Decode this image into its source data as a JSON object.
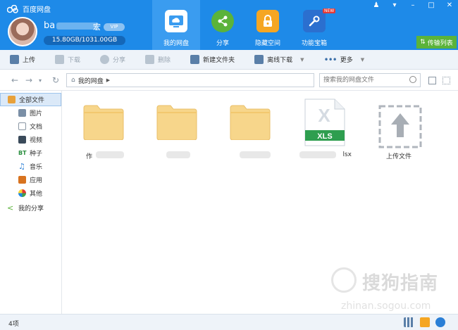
{
  "app": {
    "title": "百度网盘",
    "window_controls": [
      "bell-icon",
      "menu-icon",
      "minimize-icon",
      "maximize-icon",
      "close-icon"
    ]
  },
  "user": {
    "name": "ba",
    "name_tail": "宏",
    "vip_label": "VIP",
    "quota": "15.80GB/1031.00GB"
  },
  "nav_tabs": [
    {
      "label": "我的网盘",
      "icon": "cloud-disk-icon",
      "active": true
    },
    {
      "label": "分享",
      "icon": "share-icon",
      "active": false
    },
    {
      "label": "隐藏空间",
      "icon": "lock-icon",
      "active": false
    },
    {
      "label": "功能宝箱",
      "icon": "toolbox-icon",
      "active": false,
      "badge": "NEW"
    }
  ],
  "transfer_label": "传输列表",
  "toolbar": {
    "upload": "上传",
    "download": "下载",
    "share": "分享",
    "delete": "删除",
    "new_folder": "新建文件夹",
    "offline_download": "离线下载",
    "more": "更多"
  },
  "path": {
    "current": "我的网盘",
    "search_placeholder": "搜索我的网盘文件"
  },
  "sidebar": {
    "items": [
      {
        "label": "全部文件",
        "icon": "all-files-icon",
        "active": true
      },
      {
        "label": "图片",
        "icon": "image-icon"
      },
      {
        "label": "文档",
        "icon": "document-icon"
      },
      {
        "label": "视频",
        "icon": "video-icon"
      },
      {
        "label": "种子",
        "icon": "bt-icon"
      },
      {
        "label": "音乐",
        "icon": "music-icon"
      },
      {
        "label": "应用",
        "icon": "app-icon"
      },
      {
        "label": "其他",
        "icon": "other-icon"
      },
      {
        "label": "我的分享",
        "icon": "share-icon"
      }
    ]
  },
  "files": [
    {
      "name": "作",
      "type": "folder"
    },
    {
      "name": "",
      "type": "folder"
    },
    {
      "name": "",
      "type": "folder"
    },
    {
      "name": "lsx",
      "type": "xls",
      "badge": "XLS"
    },
    {
      "name": "上传文件",
      "type": "upload"
    }
  ],
  "status": {
    "count": "4项"
  },
  "watermark": {
    "main": "搜狗指南",
    "sub": "zhinan.sogou.com"
  },
  "colors": {
    "header": "#1e8ae8",
    "active_tab": "#3a9cf0",
    "transfer": "#5bb33a",
    "folder": "#f7d68b",
    "xls_green": "#2e9e4f"
  }
}
